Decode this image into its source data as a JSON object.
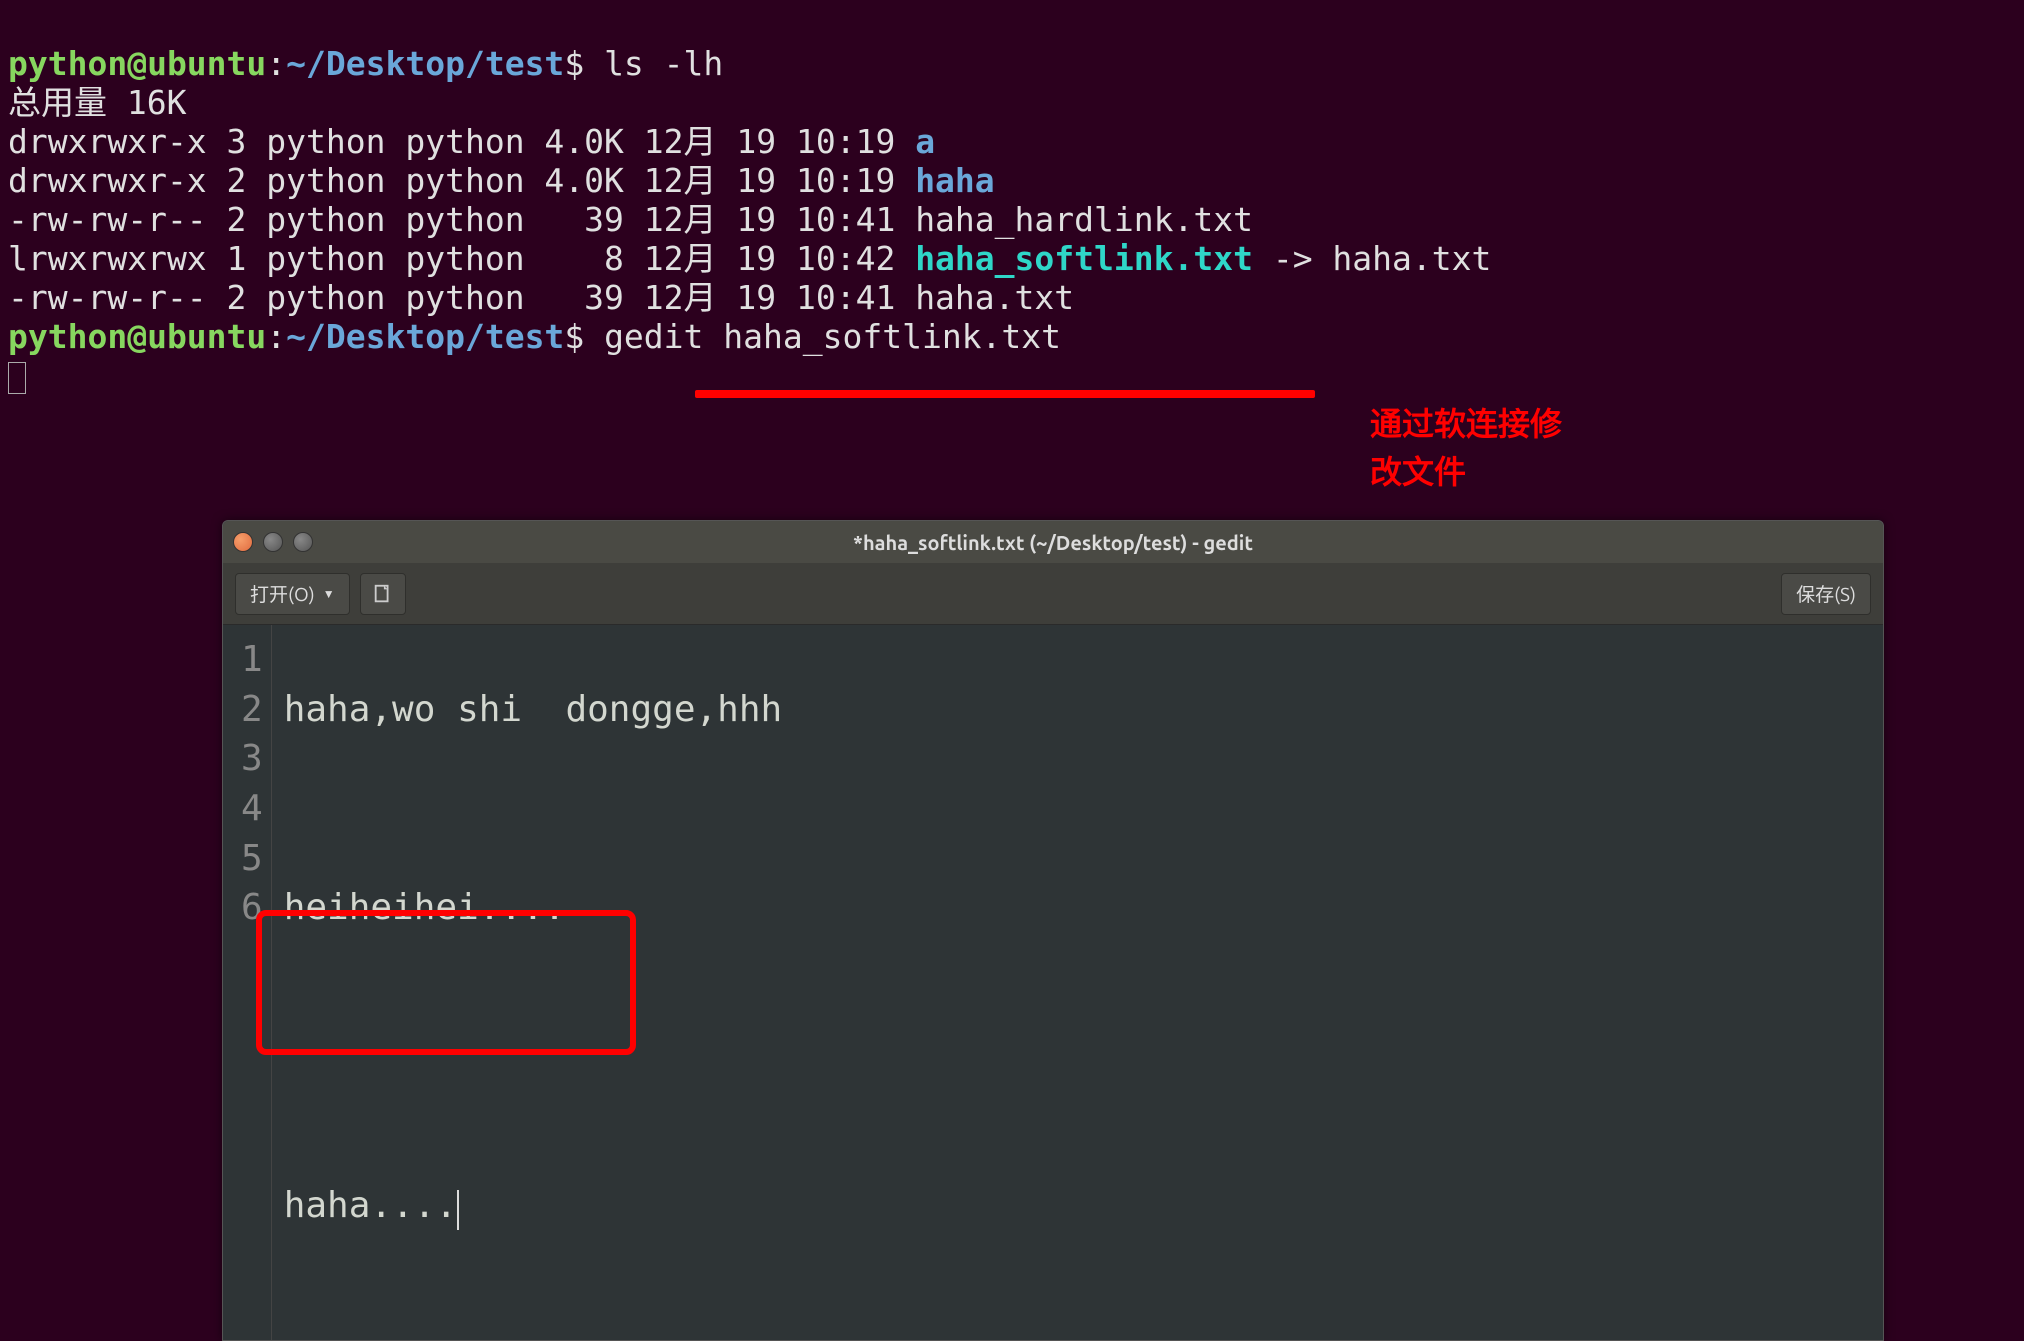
{
  "terminal": {
    "prompt_user": "python@ubuntu",
    "prompt_sep": ":",
    "prompt_path": "~/Desktop/test",
    "prompt_dollar": "$",
    "cmd1": "ls -lh",
    "total": "总用量 16K",
    "rows": [
      {
        "perm": "drwxrwxr-x 3 python python 4.0K 12月 19 10:19 ",
        "name": "a",
        "class": "dir-link",
        "suffix": ""
      },
      {
        "perm": "drwxrwxr-x 2 python python 4.0K 12月 19 10:19 ",
        "name": "haha",
        "class": "dir-link",
        "suffix": ""
      },
      {
        "perm": "-rw-rw-r-- 2 python python   39 12月 19 10:41 ",
        "name": "haha_hardlink.txt",
        "class": "normal",
        "suffix": ""
      },
      {
        "perm": "lrwxrwxrwx 1 python python    8 12月 19 10:42 ",
        "name": "haha_softlink.txt",
        "class": "sym-link",
        "suffix": " -> haha.txt"
      },
      {
        "perm": "-rw-rw-r-- 2 python python   39 12月 19 10:41 ",
        "name": "haha.txt",
        "class": "normal",
        "suffix": ""
      }
    ],
    "cmd2": "gedit haha_softlink.txt"
  },
  "annotation": {
    "line1": "通过软连接修",
    "line2": "改文件"
  },
  "gedit": {
    "title": "*haha_softlink.txt (~/Desktop/test) - gedit",
    "open_label": "打开(O)",
    "save_label": "保存(S)",
    "lines": [
      "haha,wo shi  dongge,hhh",
      "",
      "heiheihei....",
      "",
      "",
      "haha...."
    ],
    "gutter": [
      "1",
      "2",
      "3",
      "4",
      "5",
      "6"
    ]
  }
}
